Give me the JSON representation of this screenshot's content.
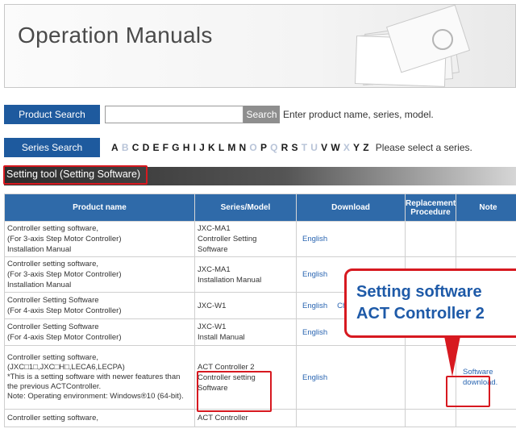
{
  "header": {
    "title": "Operation Manuals"
  },
  "product_search": {
    "button_label": "Product Search",
    "input_value": "",
    "search_label": "Search",
    "hint": "Enter product name, series, model."
  },
  "series_search": {
    "button_label": "Series Search",
    "letters": [
      {
        "ch": "A",
        "enabled": true
      },
      {
        "ch": "B",
        "enabled": false
      },
      {
        "ch": "C",
        "enabled": true
      },
      {
        "ch": "D",
        "enabled": true
      },
      {
        "ch": "E",
        "enabled": true
      },
      {
        "ch": "F",
        "enabled": true
      },
      {
        "ch": "G",
        "enabled": true
      },
      {
        "ch": "H",
        "enabled": true
      },
      {
        "ch": "I",
        "enabled": true
      },
      {
        "ch": "J",
        "enabled": true
      },
      {
        "ch": "K",
        "enabled": true
      },
      {
        "ch": "L",
        "enabled": true
      },
      {
        "ch": "M",
        "enabled": true
      },
      {
        "ch": "N",
        "enabled": true
      },
      {
        "ch": "O",
        "enabled": false
      },
      {
        "ch": "P",
        "enabled": true
      },
      {
        "ch": "Q",
        "enabled": false
      },
      {
        "ch": "R",
        "enabled": true
      },
      {
        "ch": "S",
        "enabled": true
      },
      {
        "ch": "T",
        "enabled": false
      },
      {
        "ch": "U",
        "enabled": false
      },
      {
        "ch": "V",
        "enabled": true
      },
      {
        "ch": "W",
        "enabled": true
      },
      {
        "ch": "X",
        "enabled": false
      },
      {
        "ch": "Y",
        "enabled": true
      },
      {
        "ch": "Z",
        "enabled": true
      }
    ],
    "hint": "Please select a series."
  },
  "section": {
    "title": "Setting tool (Setting Software)"
  },
  "table": {
    "headers": {
      "product": "Product name",
      "series": "Series/Model",
      "download": "Download",
      "replacement_1": "Replacement",
      "replacement_2": "Procedure",
      "note": "Note"
    },
    "rows": [
      {
        "product": [
          "Controller setting software,",
          "(For 3-axis Step Motor Controller)",
          "Installation Manual"
        ],
        "series": [
          "JXC-MA1",
          "Controller Setting",
          "Software"
        ],
        "download": "English",
        "download2": "",
        "note": []
      },
      {
        "product": [
          "Controller setting software,",
          "(For 3-axis Step Motor Controller)",
          "Installation Manual"
        ],
        "series": [
          "JXC-MA1",
          "Installation Manual"
        ],
        "download": "English",
        "download2": "",
        "note": []
      },
      {
        "product": [
          "Controller Setting Software",
          "(For 4-axis Step Motor Controller)"
        ],
        "series": [
          "JXC-W1"
        ],
        "download": "English",
        "download2": "Chin",
        "note": []
      },
      {
        "product": [
          "Controller Setting Software",
          "(For 4-axis Step Motor Controller)"
        ],
        "series": [
          "JXC-W1",
          "Install Manual"
        ],
        "download": "English",
        "download2": "",
        "note": []
      },
      {
        "product": [
          "Controller setting software,",
          "(JXC□1□,JXC□H□,LECA6,LECPA)",
          "*This is a setting software with newer features than",
          "the previous ACTController.",
          "Note: Operating environment: Windows®10 (64-bit)."
        ],
        "series": [
          "ACT Controller 2",
          "Controller setting",
          "Software"
        ],
        "download": "English",
        "download2": "",
        "note": [
          "Software",
          "download."
        ]
      },
      {
        "product": [
          "Controller setting software,"
        ],
        "series": [
          "ACT Controller"
        ],
        "download": "",
        "download2": "",
        "note": []
      }
    ]
  },
  "callout": {
    "line1": "Setting software",
    "line2": "ACT Controller 2"
  },
  "colors": {
    "accent_blue": "#1e5a9e",
    "table_header": "#2f6aa9",
    "highlight_red": "#d71920",
    "link": "#2a65b1"
  }
}
